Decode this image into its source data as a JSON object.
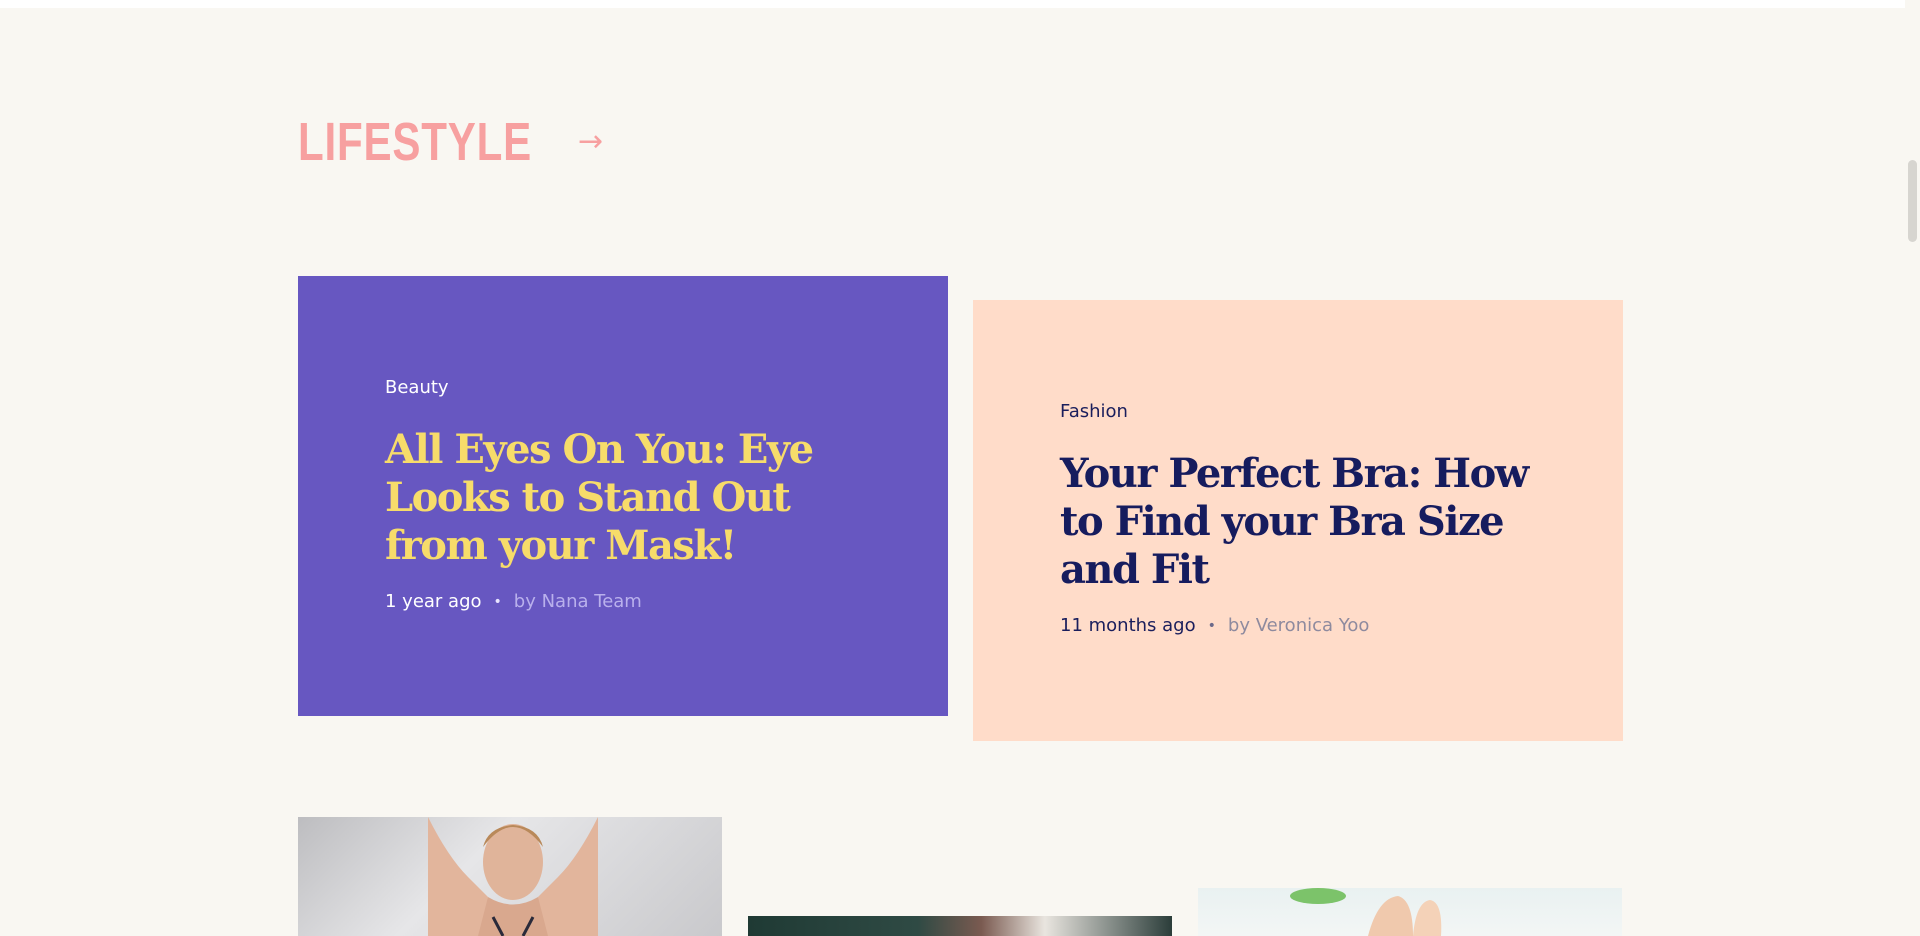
{
  "section": {
    "title": "LIFESTYLE",
    "arrow_icon": "arrow-right-icon",
    "color": "#f7a0a0"
  },
  "cards": [
    {
      "category": "Beauty",
      "headline": "All Eyes On You: Eye Looks to Stand Out from your Mask!",
      "time": "1 year ago",
      "author": "by Nana Team",
      "background": "#6757c1",
      "headline_color": "#f7dc6a"
    },
    {
      "category": "Fashion",
      "headline": "Your Perfect Bra: How to Find your Bra Size and Fit",
      "time": "11 months ago",
      "author": "by Veronica Yoo",
      "background": "#ffdcc9",
      "headline_color": "#161c5e"
    }
  ],
  "thumbnails": [
    {
      "subject": "woman-portrait"
    },
    {
      "subject": "store-interior"
    },
    {
      "subject": "hand-with-leaf"
    }
  ],
  "colors": {
    "page_background": "#f9f7f2"
  }
}
